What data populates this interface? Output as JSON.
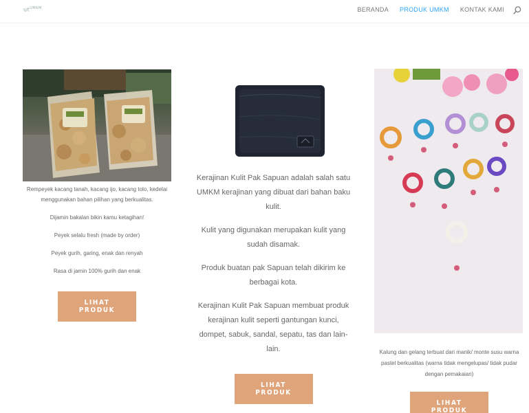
{
  "header": {
    "logo_text": "@utᴹᴬᴺ",
    "nav": [
      {
        "label": "BERANDA"
      },
      {
        "label": "PRODUK UMKM",
        "active": true
      },
      {
        "label": "KONTAK KAMI"
      }
    ],
    "search_icon": "search-icon",
    "accent_color": "#2ea3f2"
  },
  "products": [
    {
      "image": "peyek-kacang-bags",
      "paragraphs": [
        "Rempeyek kacang tanah, kacang ijo, kacang tolo, kedelai menggunakan bahan pilihan yang berkualitas.",
        "Dijamin bakalan bikin kamu ketagihan!",
        "Peyek selalu fresh (made by order)",
        "Peyek gurih, garing, enak dan renyah",
        "Rasa di jamin 100% gurih dan enak"
      ],
      "button_label": "LIHAT PRODUK"
    },
    {
      "image": "leather-wallet",
      "paragraphs": [
        "Kerajinan Kulit Pak Sapuan adalah salah satu UMKM kerajinan yang dibuat dari bahan baku kulit.",
        "Kulit yang digunakan merupakan kulit yang sudah disamak.",
        "Produk buatan pak Sapuan telah dikirim ke berbagai kota.",
        "Kerajinan Kulit Pak Sapuan membuat produk kerajinan kulit seperti gantungan kunci, dompet, sabuk, sandal, sepatu, tas dan lain-lain."
      ],
      "button_label": "LIHAT PRODUK"
    },
    {
      "image": "beaded-bracelets-necklaces",
      "paragraphs": [
        "Kalung dan gelang terbuat dari manik/ monte susu warna pastel berkualitas (warna tidak mengelupas/ tidak pudar dengan pemakaian)"
      ],
      "button_label": "LIHAT PRODUK"
    }
  ],
  "button_color": "#e0a47a"
}
